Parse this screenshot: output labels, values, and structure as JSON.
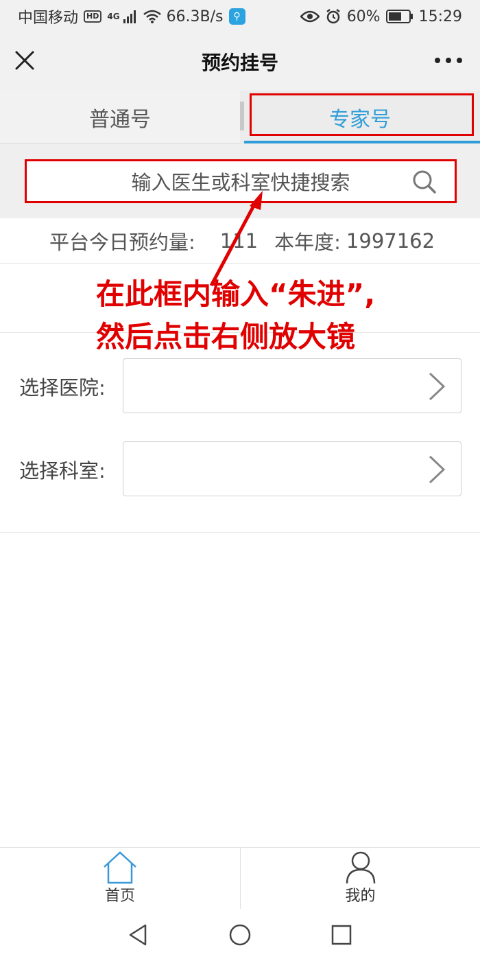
{
  "status_bar": {
    "carrier": "中国移动",
    "hd": "HD",
    "network": "4G",
    "speed": "66.3B/s",
    "battery": "60%",
    "time": "15:29"
  },
  "header": {
    "title": "预约挂号"
  },
  "tabs": [
    {
      "label": "普通号",
      "active": false
    },
    {
      "label": "专家号",
      "active": true
    }
  ],
  "search": {
    "placeholder": "输入医生或科室快捷搜索"
  },
  "stats": {
    "today_label": "平台今日预约量:",
    "today_value": "111",
    "year_label": "本年度:",
    "year_value": "1997162"
  },
  "annotation": {
    "line1": "在此框内输入“朱进”,",
    "line2": "然后点击右侧放大镜"
  },
  "form": {
    "hospital_label": "选择医院:",
    "department_label": "选择科室:"
  },
  "bottom_nav": [
    {
      "label": "首页",
      "icon": "home-icon"
    },
    {
      "label": "我的",
      "icon": "user-icon"
    }
  ],
  "colors": {
    "accent": "#2f9ed8",
    "annotation_red": "#e00000"
  }
}
